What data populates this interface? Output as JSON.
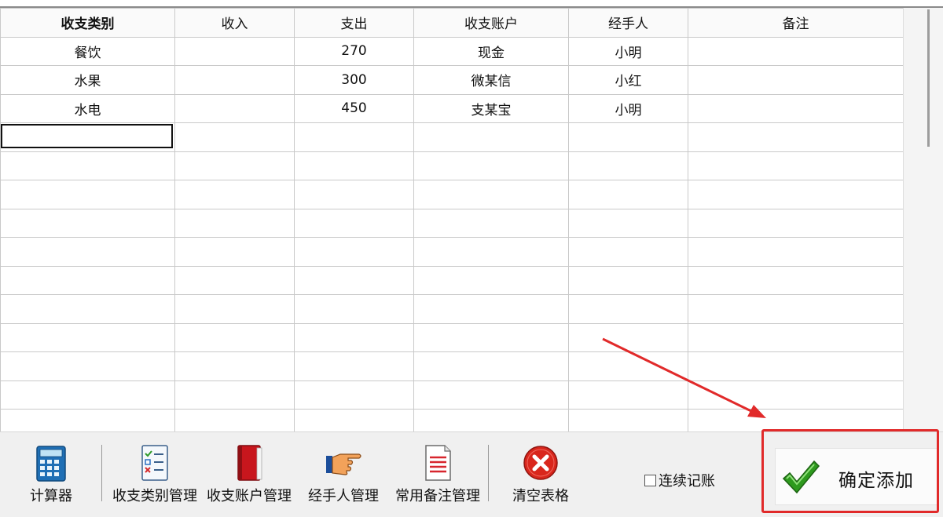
{
  "grid": {
    "headers": [
      "收支类别",
      "收入",
      "支出",
      "收支账户",
      "经手人",
      "备注"
    ],
    "rows": [
      [
        "餐饮",
        "",
        "270",
        "现金",
        "小明",
        ""
      ],
      [
        "水果",
        "",
        "300",
        "微某信",
        "小红",
        ""
      ],
      [
        "水电",
        "",
        "450",
        "支某宝",
        "小明",
        ""
      ]
    ]
  },
  "toolbar": {
    "calculator": "计算器",
    "category_mgmt": "收支类别管理",
    "account_mgmt": "收支账户管理",
    "handler_mgmt": "经手人管理",
    "notes_mgmt": "常用备注管理",
    "clear_table": "清空表格",
    "continuous_label": "连续记账",
    "confirm_label": "确定添加"
  },
  "colors": {
    "highlight": "#e12a2a",
    "check": "#2e9a1e",
    "clear_icon": "#d9261c",
    "book": "#c8161d"
  },
  "icons": [
    "calculator-icon",
    "checklist-icon",
    "book-icon",
    "pointing-hand-icon",
    "document-icon",
    "clear-x-icon",
    "checkmark-icon",
    "annotation-arrow"
  ]
}
